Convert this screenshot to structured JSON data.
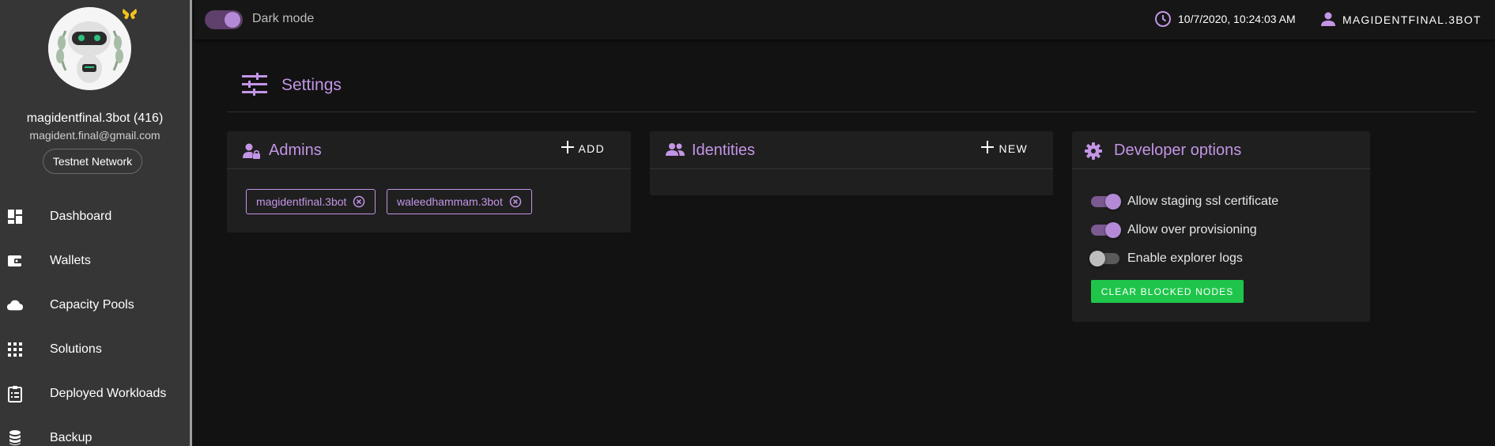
{
  "sidebar": {
    "user_name": "magidentfinal.3bot (416)",
    "user_email": "magident.final@gmail.com",
    "network": "Testnet Network",
    "items": [
      {
        "label": "Dashboard",
        "icon": "dashboard-icon"
      },
      {
        "label": "Wallets",
        "icon": "wallet-icon"
      },
      {
        "label": "Capacity Pools",
        "icon": "cloud-icon"
      },
      {
        "label": "Solutions",
        "icon": "apps-grid-icon"
      },
      {
        "label": "Deployed Workloads",
        "icon": "clipboard-list-icon"
      },
      {
        "label": "Backup",
        "icon": "database-icon"
      }
    ]
  },
  "topbar": {
    "dark_mode_label": "Dark mode",
    "dark_mode_on": true,
    "datetime": "10/7/2020, 10:24:03 AM",
    "account": "MAGIDENTFINAL.3BOT"
  },
  "page": {
    "title": "Settings"
  },
  "admins": {
    "title": "Admins",
    "action": "ADD",
    "chips": [
      "magidentfinal.3bot",
      "waleedhammam.3bot"
    ]
  },
  "identities": {
    "title": "Identities",
    "action": "NEW"
  },
  "developer": {
    "title": "Developer options",
    "options": [
      {
        "label": "Allow staging ssl certificate",
        "enabled": true
      },
      {
        "label": "Allow over provisioning",
        "enabled": true
      },
      {
        "label": "Enable explorer logs",
        "enabled": false
      }
    ],
    "clear_button": "CLEAR BLOCKED NODES"
  },
  "colors": {
    "accent": "#c395e6",
    "success": "#1fc54a",
    "sidebar": "#363636",
    "background": "#121212"
  }
}
